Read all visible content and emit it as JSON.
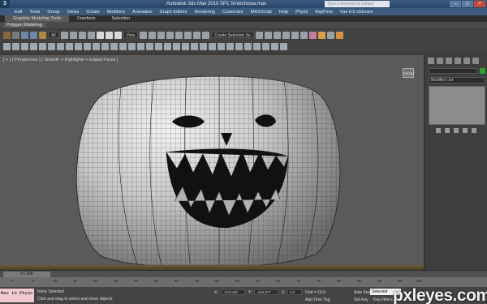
{
  "window": {
    "title": "Autodesk 3ds Max  2010 SP1     Smiechowa.max",
    "search_placeholder": "Type a keyword or phrase",
    "logo": "3",
    "controls": [
      "–",
      "□",
      "×"
    ]
  },
  "menubar": {
    "items": [
      "Edit",
      "Tools",
      "Group",
      "Views",
      "Create",
      "Modifiers",
      "Animation",
      "Graph Editors",
      "Rendering",
      "Customize",
      "MAXScript",
      "Help",
      "Phys2",
      "RayFlow",
      "Vue 6.5 xStream"
    ]
  },
  "ribbon": {
    "tabs": [
      "Graphite Modeling Tools",
      "Freeform",
      "Selection"
    ],
    "active_tab": 0,
    "panel_label": "Polygon Modeling"
  },
  "toolbar": {
    "selection_filter": "All",
    "view_dropdown": "View",
    "named_selection": "Create Selection Se"
  },
  "viewport": {
    "label": "[ + ] [ Perspective ] [ Smooth + Highlights + Edged Faces ]",
    "viewcube_label": "FRONT"
  },
  "command_panel": {
    "modifier_list": "Modifier List",
    "colors": {
      "swatch": "#2aa52a"
    }
  },
  "timeline": {
    "frame_readout": "0 / 100",
    "ticks": [
      "0",
      "5",
      "10",
      "15",
      "20",
      "25",
      "30",
      "35",
      "40",
      "45",
      "50",
      "55",
      "60",
      "65",
      "70",
      "75",
      "80",
      "85",
      "90",
      "95",
      "100"
    ]
  },
  "statusbar": {
    "maxscript": "Max to Physc",
    "selection_status": "None Selected",
    "prompt": "Click and drag to select and move objects",
    "x_value": "-102,848",
    "y_value": "-449,977",
    "z_value": "0,0",
    "grid": "Grid = 10,0",
    "auto_key": "Auto Key",
    "selected": "Selected",
    "set_key": "Set Key",
    "key_filters": "Key Filters...",
    "add_time_tag": "Add Time Tag"
  },
  "watermark": "pxleyes.com"
}
